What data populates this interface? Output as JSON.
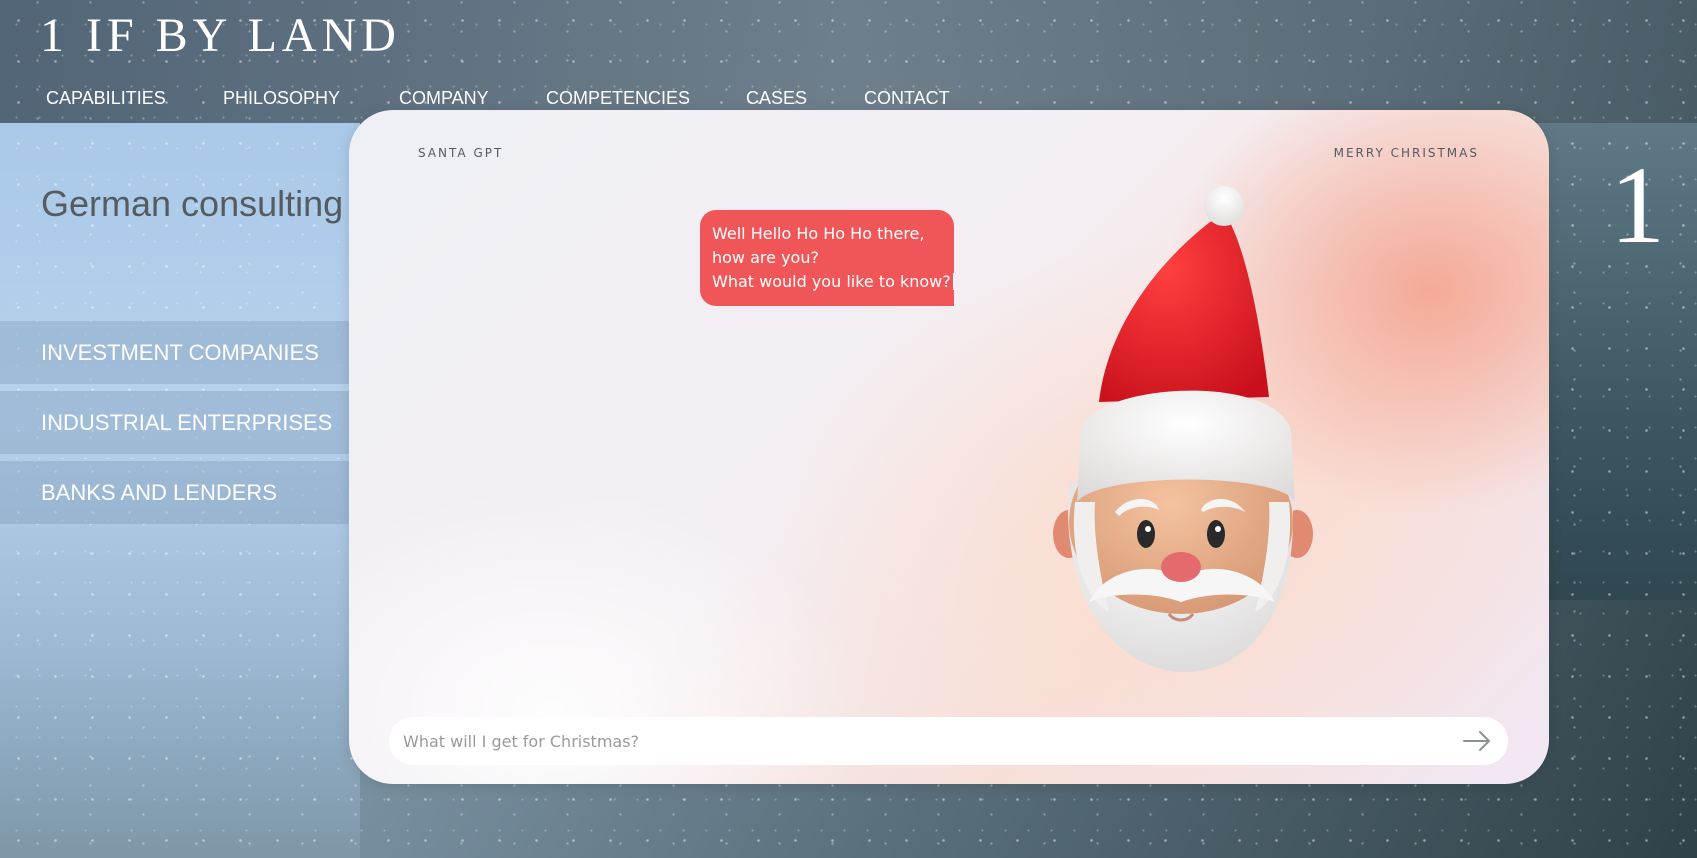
{
  "site": {
    "logo_text": "1 IF BY LAND"
  },
  "nav": {
    "items": [
      "CAPABILITIES",
      "PHILOSOPHY",
      "COMPANY",
      "COMPETENCIES",
      "CASES",
      "CONTACT"
    ]
  },
  "hero": {
    "headline": "German consulting",
    "categories": [
      "INVESTMENT COMPANIES",
      "INDUSTRIAL ENTERPRISES",
      "BANKS AND LENDERS"
    ],
    "partial_glyph": "1"
  },
  "chat": {
    "brand_label": "SANTA GPT",
    "greeting_label": "MERRY CHRISTMAS",
    "message_lines": [
      "Well Hello Ho Ho Ho there,",
      "how are you?",
      "What would you like to know?"
    ],
    "input_placeholder": "What will I get for Christmas?",
    "input_value": "",
    "send_icon": "arrow-right-icon",
    "bubble_color": "#f05657"
  },
  "colors": {
    "nav_text": "#ffffff",
    "headline": "#555b60",
    "accent_red": "#f05657"
  }
}
